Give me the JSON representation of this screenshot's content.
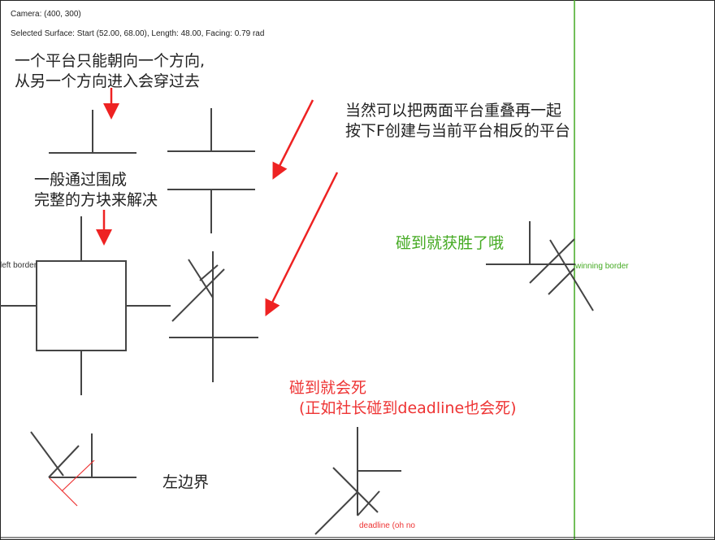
{
  "hud": {
    "camera": "Camera: (400, 300)",
    "selected_surface": "Selected Surface: Start (52.00, 68.00), Length: 48.00, Facing: 0.79 rad"
  },
  "notes": {
    "one_direction_line1": "一个平台只能朝向一个方向,",
    "one_direction_line2": "从另一个方向进入会穿过去",
    "overlap_line1": "当然可以把两面平台重叠再一起",
    "overlap_line2": "按下F创建与当前平台相反的平台",
    "block_line1": "一般通过围成",
    "block_line2": "完整的方块来解决",
    "win_note": "碰到就获胜了哦",
    "death_line1": "碰到就会死",
    "death_line2": "(正如社长碰到deadline也会死)",
    "left_border_note": "左边界"
  },
  "labels": {
    "left_border": "left border",
    "winning_border": "winning border",
    "deadline": "deadline (oh no"
  },
  "colors": {
    "platform": "#444444",
    "annotation_arrow": "#ee2222",
    "win": "#44aa22",
    "death": "#ee3333",
    "border_frame": "#222222"
  }
}
